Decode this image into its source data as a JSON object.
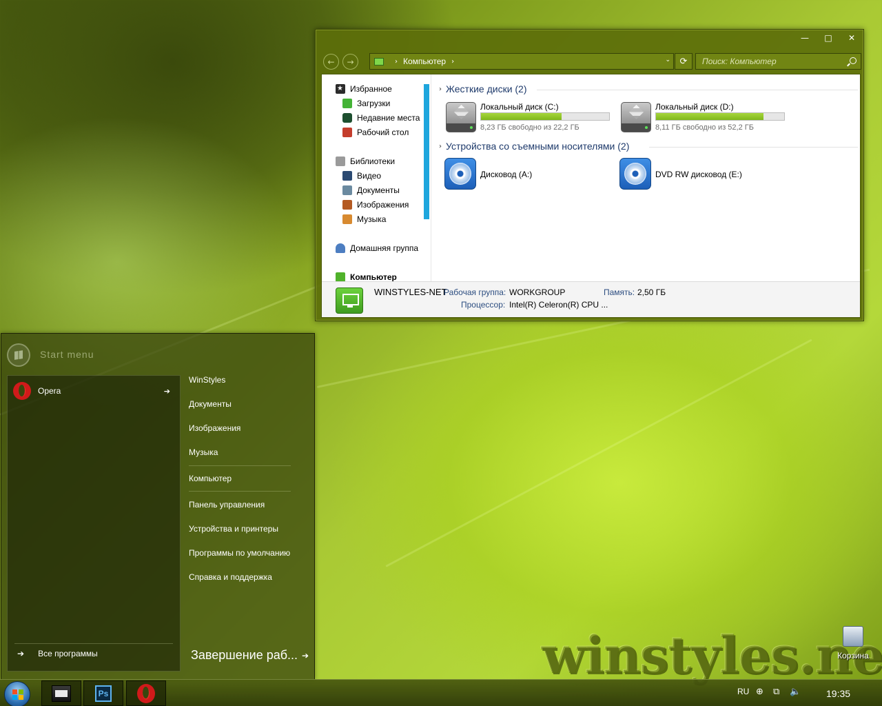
{
  "explorer": {
    "controls": {
      "minimize": "—",
      "maximize": "□",
      "close": "✕"
    },
    "nav": {
      "back": "←",
      "forward": "→"
    },
    "address": {
      "location": "Компьютер",
      "separator": "›",
      "dropdown": "⌄"
    },
    "refresh": "⟳",
    "search_placeholder": "Поиск: Компьютер",
    "sidebar": {
      "favorites": {
        "label": "Избранное",
        "items": [
          {
            "label": "Загрузки",
            "icon": "downloads-icon"
          },
          {
            "label": "Недавние места",
            "icon": "recent-places-icon"
          },
          {
            "label": "Рабочий стол",
            "icon": "desktop-icon"
          }
        ]
      },
      "libraries": {
        "label": "Библиотеки",
        "items": [
          {
            "label": "Видео",
            "icon": "video-icon"
          },
          {
            "label": "Документы",
            "icon": "documents-icon"
          },
          {
            "label": "Изображения",
            "icon": "images-icon"
          },
          {
            "label": "Музыка",
            "icon": "music-icon"
          }
        ]
      },
      "homegroup": "Домашняя группа",
      "computer": "Компьютер"
    },
    "groups": {
      "hard_drives": "Жесткие диски (2)",
      "removable": "Устройства со съемными носителями (2)"
    },
    "drives": [
      {
        "name": "Локальный диск (C:)",
        "free": "8,23 ГБ свободно из 22,2 ГБ",
        "used_percent": 63,
        "type": "hdd"
      },
      {
        "name": "Локальный диск  (D:)",
        "free": "8,11 ГБ свободно из 52,2 ГБ",
        "used_percent": 84,
        "type": "hdd"
      },
      {
        "name": "Дисковод (A:)",
        "type": "optical"
      },
      {
        "name": "DVD RW дисковод (E:)",
        "type": "optical"
      }
    ],
    "details": {
      "computer_name": "WINSTYLES-NET",
      "workgroup_label": "Рабочая группа:",
      "workgroup_value": "WORKGROUP",
      "memory_label": "Память:",
      "memory_value": "2,50 ГБ",
      "cpu_label": "Процессор:",
      "cpu_value": "Intel(R) Celeron(R) CPU ..."
    }
  },
  "start_menu": {
    "title": "Start menu",
    "pinned": [
      {
        "label": "Opera",
        "arrow": "➔"
      }
    ],
    "all_programs": {
      "arrow": "➔",
      "label": "Все программы"
    },
    "links_top": [
      "WinStyles",
      "Документы",
      "Изображения",
      "Музыка"
    ],
    "computer": "Компьютер",
    "links_bottom": [
      "Панель управления",
      "Устройства и принтеры",
      "Программы по умолчанию",
      "Справка и поддержка"
    ],
    "shutdown": {
      "label": "Завершение раб...",
      "arrow": "➔"
    }
  },
  "desktop": {
    "watermark": "winstyles.net",
    "recycle_bin": "Корзина"
  },
  "taskbar": {
    "apps": [
      "explorer-icon",
      "photoshop-icon",
      "opera-icon"
    ],
    "photoshop_label": "Ps",
    "language": "RU",
    "clock": "19:35",
    "tray_icons": {
      "update": "⊕",
      "network": "⧉",
      "volume": "🔈"
    }
  },
  "colors": {
    "accent_green": "#5c6e0a",
    "drive_bar": "#8dc426",
    "nav_scroll": "#1ea6dd"
  }
}
